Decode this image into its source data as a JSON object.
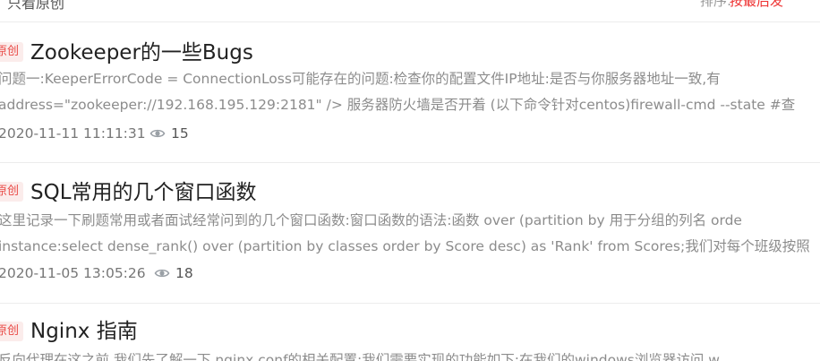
{
  "header": {
    "left_text": "只看原创",
    "sort_label": "排序:",
    "sort_value": "按最后发"
  },
  "articles": [
    {
      "badge": "原创",
      "title": "Zookeeper的一些Bugs",
      "line1": "问题一:KeeperErrorCode = ConnectionLoss可能存在的问题:检查你的配置文件IP地址:是否与你服务器地址一致,有",
      "line2": "address=\"zookeeper://192.168.195.129:2181\" /> 服务器防火墙是否开着 (以下命令针对centos)firewall-cmd --state #查",
      "date": "2020-11-11 11:11:31",
      "views": "15"
    },
    {
      "badge": "原创",
      "title": "SQL常用的几个窗口函数",
      "line1": "这里记录一下刷题常用或者面试经常问到的几个窗口函数:窗口函数的语法:函数 over (partition by 用于分组的列名 orde",
      "line2": "instance:select dense_rank() over (partition by classes order by Score desc) as 'Rank' from Scores;我们对每个班级按照",
      "date": "2020-11-05 13:05:26",
      "views": "18"
    },
    {
      "badge": "原创",
      "title": "Nginx 指南",
      "line1": "反向代理在这之前,我们先了解一下 nginx.conf的相关配置:我们需要实现的功能如下:在我们的windows浏览器访问 w"
    }
  ],
  "icons": {
    "views": "eye-icon"
  },
  "colors": {
    "badge_text": "#e94a46",
    "badge_bg": "#fbeceb",
    "sort_accent": "#e33"
  }
}
